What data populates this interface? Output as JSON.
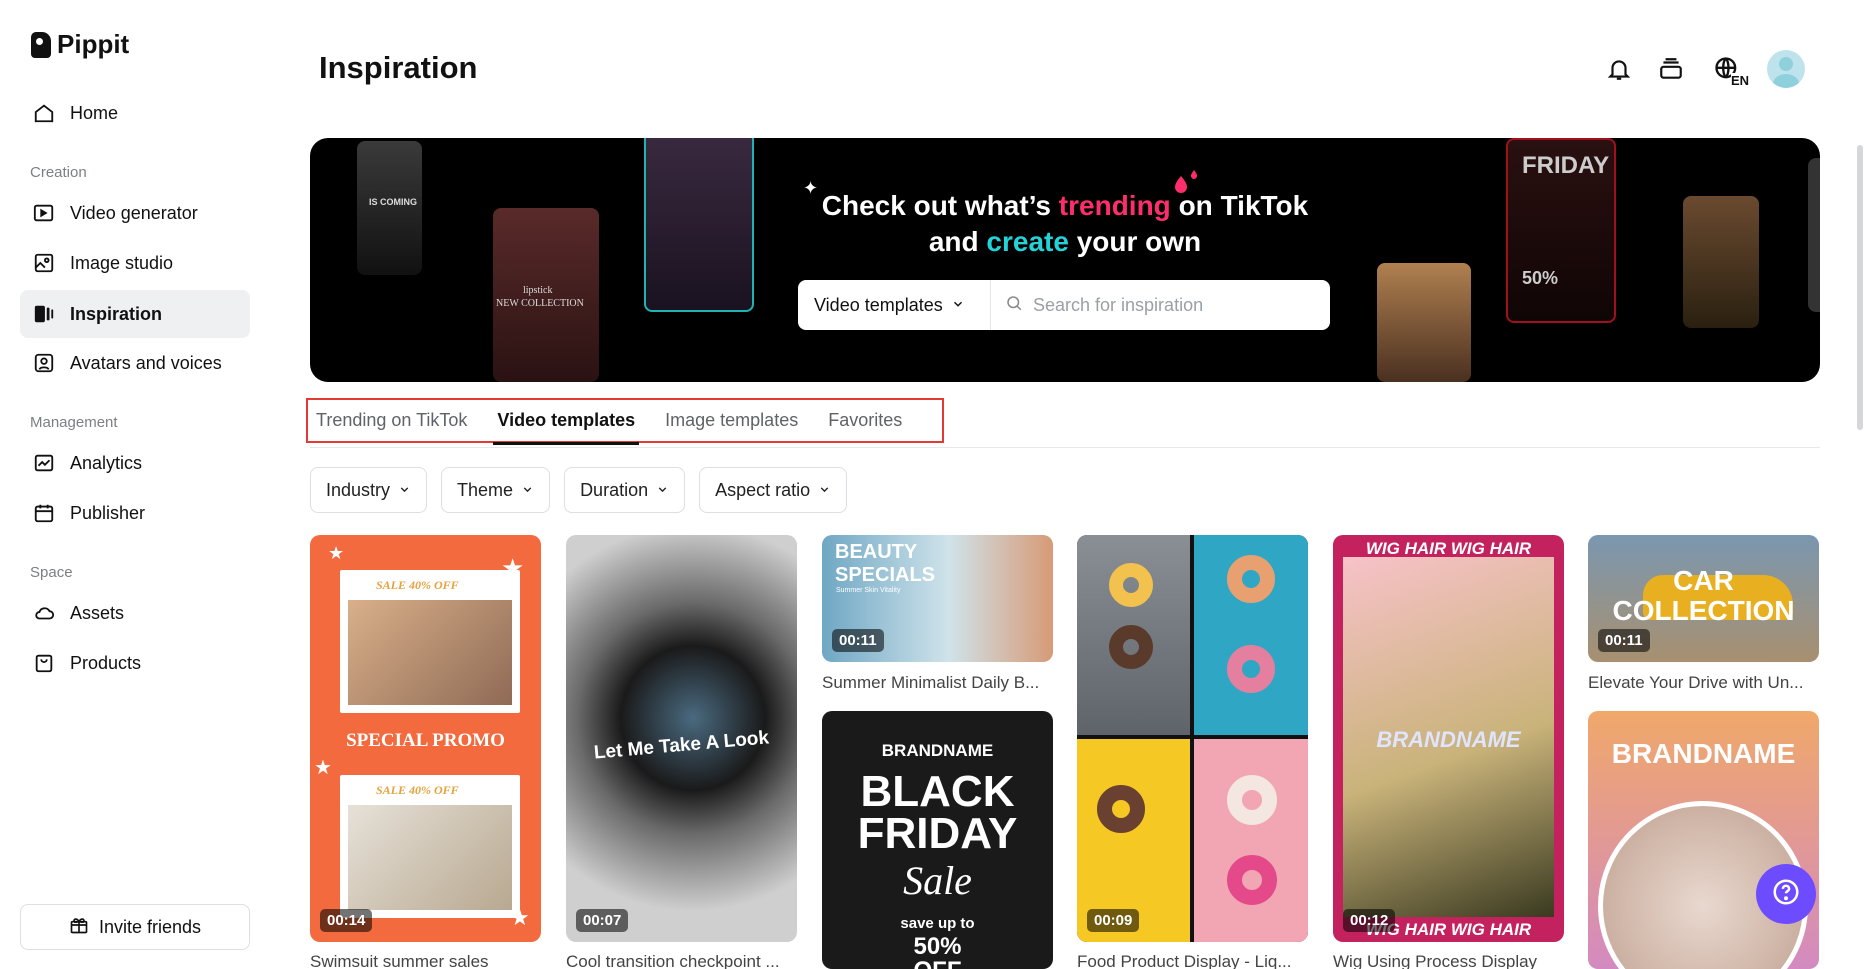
{
  "app": {
    "name": "Pippit"
  },
  "sidebar": {
    "items": [
      {
        "label": "Home",
        "icon": "home-icon"
      },
      {
        "label": "Video generator",
        "icon": "video-plus-icon"
      },
      {
        "label": "Image studio",
        "icon": "image-edit-icon"
      },
      {
        "label": "Inspiration",
        "icon": "inspiration-icon",
        "active": true
      },
      {
        "label": "Avatars and voices",
        "icon": "avatar-voice-icon"
      },
      {
        "label": "Analytics",
        "icon": "analytics-icon"
      },
      {
        "label": "Publisher",
        "icon": "calendar-icon"
      },
      {
        "label": "Assets",
        "icon": "cloud-icon"
      },
      {
        "label": "Products",
        "icon": "bag-icon"
      }
    ],
    "sections": {
      "creation": "Creation",
      "management": "Management",
      "space": "Space"
    },
    "invite_label": "Invite friends"
  },
  "header": {
    "title": "Inspiration",
    "language": "EN"
  },
  "banner": {
    "line1_a": "Check out what’s ",
    "line1_b": "trending",
    "line1_c": " on TikTok",
    "line2_a": "and ",
    "line2_b": "create",
    "line2_c": " your own",
    "select_value": "Video templates",
    "search_placeholder": "Search for inspiration",
    "thumb_texts": {
      "t1": "IS COMING",
      "t2": "lipstick",
      "t3": "NEW COLLECTION",
      "t4": "FRIDAY",
      "t5": "50%"
    }
  },
  "tabs": [
    {
      "label": "Trending on TikTok"
    },
    {
      "label": "Video templates",
      "active": true
    },
    {
      "label": "Image templates"
    },
    {
      "label": "Favorites"
    }
  ],
  "filters": [
    {
      "label": "Industry"
    },
    {
      "label": "Theme"
    },
    {
      "label": "Duration"
    },
    {
      "label": "Aspect ratio"
    }
  ],
  "cards": [
    {
      "duration": "00:14",
      "caption": "Swimsuit summer sales",
      "text1": "SPECIAL PROMO",
      "text2": "SALE 40% OFF",
      "text3": "SALE 40% OFF"
    },
    {
      "duration": "00:07",
      "caption": "Cool transition checkpoint ...",
      "text1": "Let Me Take A Look"
    },
    {
      "duration": "00:11",
      "caption": "Summer Minimalist Daily B...",
      "text1": "BEAUTY",
      "text2": "SPECIALS",
      "text3": "Summer Skin Vitality"
    },
    {
      "duration": "",
      "caption": "",
      "text1": "BRANDNAME",
      "text2": "BLACK",
      "text3": "FRIDAY",
      "text4": "Sale",
      "text5": "save up to",
      "text6": "50%",
      "text7": "OFF"
    },
    {
      "duration": "00:09",
      "caption": "Food Product Display - Liq..."
    },
    {
      "duration": "00:12",
      "caption": "Wig Using Process Display",
      "text1": "WIG HAIR WIG HAIR",
      "text2": "BRANDNAME",
      "text3": "WIG HAIR WIG HAIR"
    },
    {
      "duration": "00:11",
      "caption": "Elevate Your Drive with Un...",
      "text1": "CAR",
      "text2": "COLLECTION"
    },
    {
      "duration": "",
      "caption": "",
      "text1": "BRANDNAME"
    }
  ]
}
